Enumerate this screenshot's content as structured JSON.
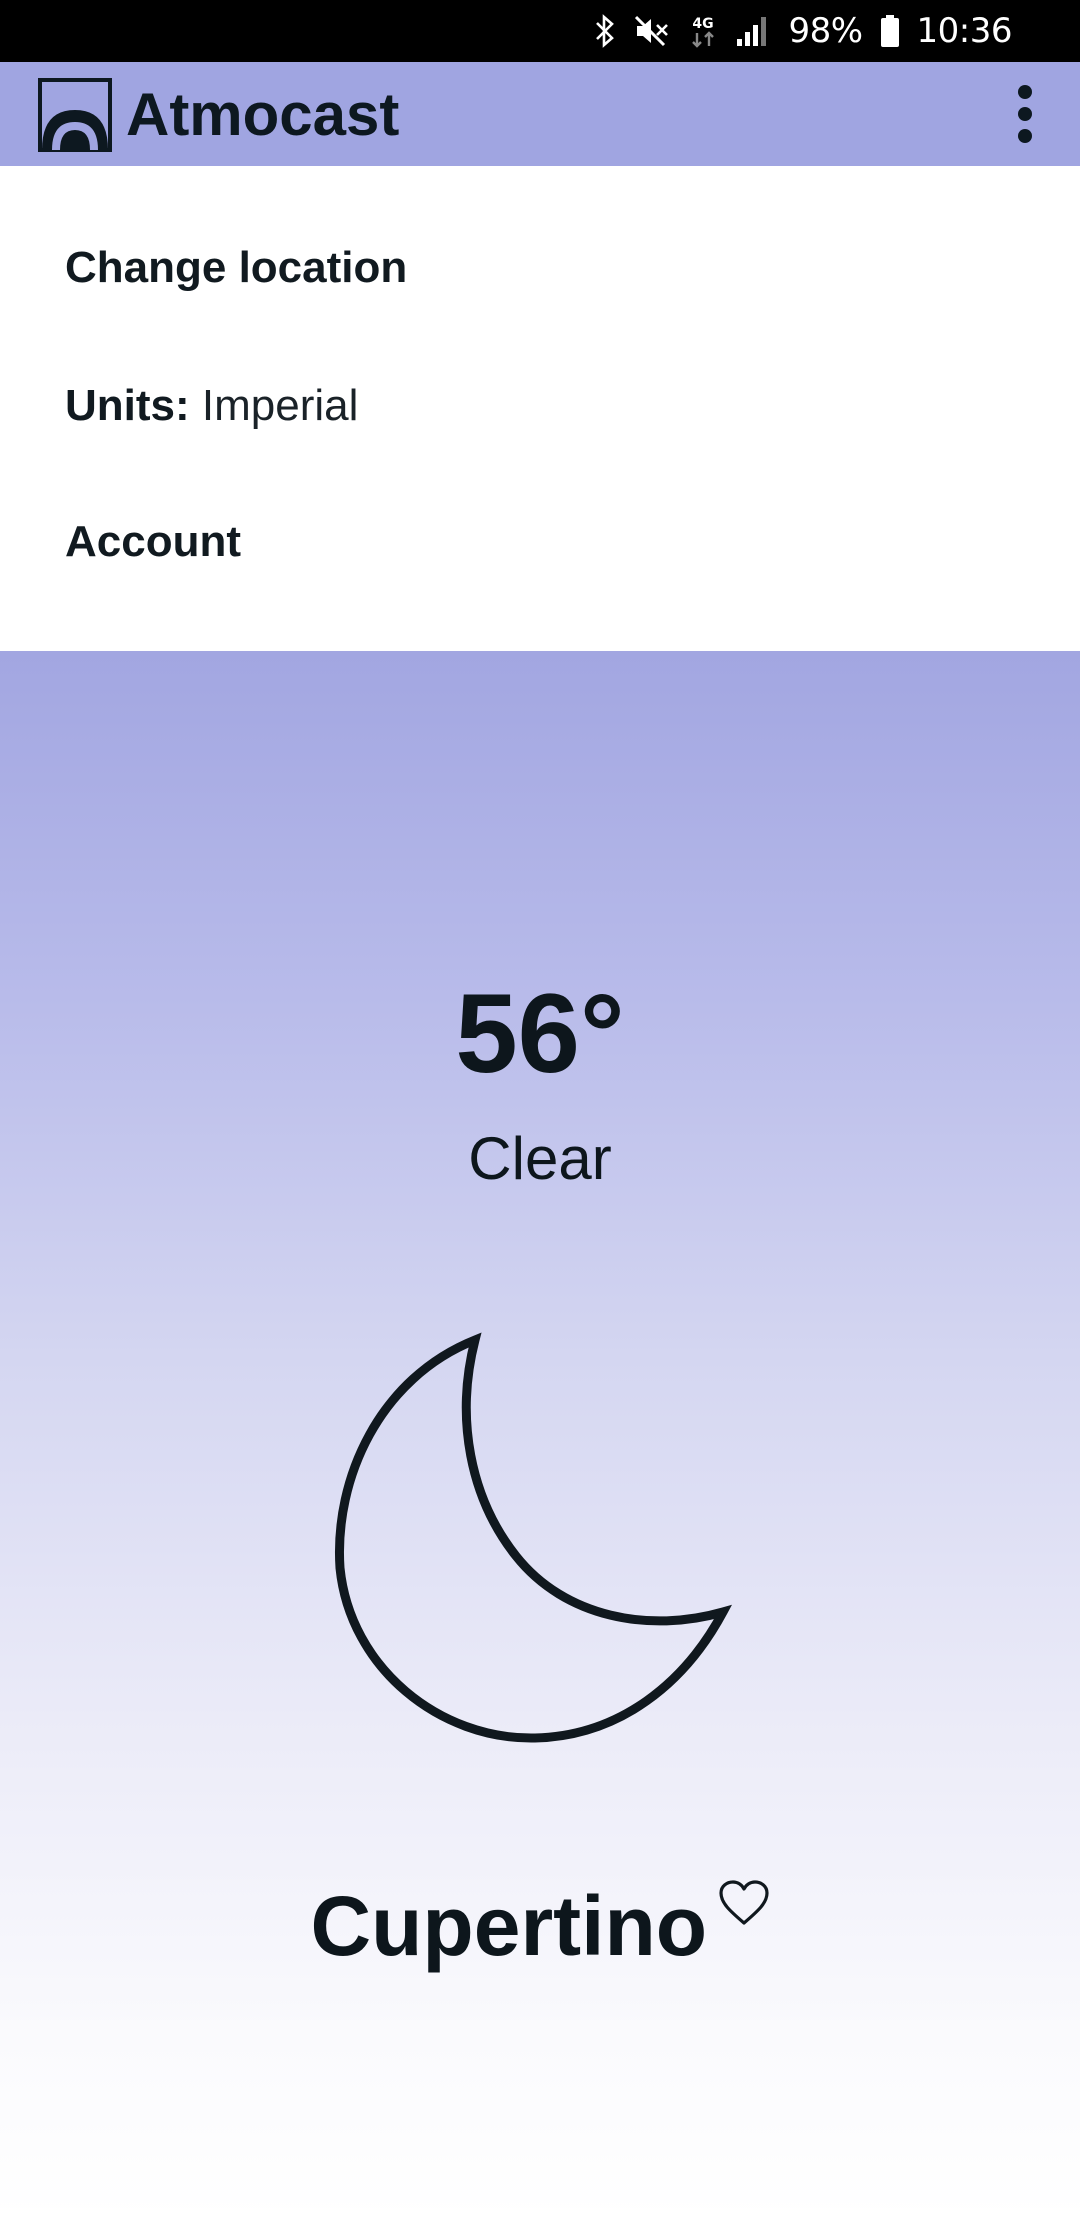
{
  "status_bar": {
    "icons": [
      "bluetooth-icon",
      "mute-icon",
      "network-4g-icon",
      "signal-icon",
      "battery-icon"
    ],
    "network_label": "4G",
    "battery": "98%",
    "time": "10:36"
  },
  "app_bar": {
    "title": "Atmocast",
    "logo_icon": "atmocast-logo-icon",
    "menu_icon": "more-vert-icon",
    "color": "#a0a5e1"
  },
  "menu": {
    "change_location": "Change location",
    "units_label": "Units:",
    "units_value": "Imperial",
    "account": "Account"
  },
  "weather": {
    "temperature": "56°",
    "condition": "Clear",
    "condition_icon": "moon-icon",
    "location": "Cupertino",
    "favorite_icon": "heart-outline-icon"
  }
}
